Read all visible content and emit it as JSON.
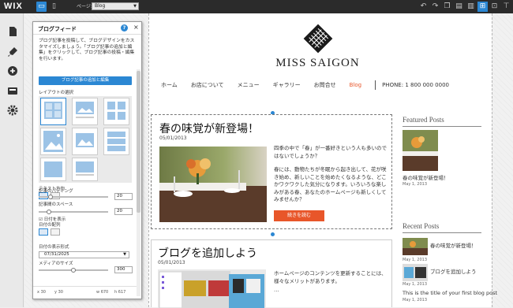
{
  "topbar": {
    "logo": "WIX",
    "page_label": "ページ:",
    "page_value": "Blog",
    "icons": [
      "desktop-view-icon",
      "mobile-view-icon",
      "undo-icon",
      "redo-icon",
      "copy-icon",
      "paste-icon",
      "gridlines-icon",
      "snap-icon",
      "rulers-icon"
    ]
  },
  "leftrail": {
    "icons": [
      "pages-icon",
      "design-icon",
      "add-icon",
      "app-market-icon",
      "settings-icon"
    ]
  },
  "panel": {
    "title": "ブログフィード",
    "help": "?",
    "close": "×",
    "description": "ブログ記事を投稿して、ブログデザインをカスタマイズしましょう。「ブログ記事の追加と編集」をクリックして、ブログ記事の投稿・編集を行います。",
    "add_button": "ブログ記事の追加と編集",
    "layout_label": "レイアウトの選択",
    "text_direction_label": "テキスト方向",
    "padding_label": "記事のパディング",
    "padding_value": "20",
    "padding_level": 0.15,
    "spacing_label": "記事間のスペース",
    "spacing_value": "20",
    "spacing_level": 0.12,
    "show_date_label": "日付を表示",
    "date_align_label": "日付の配列",
    "date_format_label": "日付の表示形式",
    "date_format_value": "07/31/2025",
    "media_size_label": "メディアのサイズ",
    "media_size_value": "300",
    "media_size_level": 0.5,
    "x_label": "x",
    "x_value": "30",
    "y_label": "y",
    "y_value": "30",
    "w_label": "w",
    "w_value": "670",
    "h_label": "h",
    "h_value": "617"
  },
  "site": {
    "brand": "MISS SAIGON",
    "nav": [
      "ホーム",
      "お店について",
      "メニュー",
      "ギャラリー",
      "お問合せ",
      "Blog"
    ],
    "active_nav": "Blog",
    "phone": "PHONE: 1 800 000 0000",
    "post1": {
      "title": "春の味覚が新登場！",
      "date": "05/01/2013",
      "text1": "四季の中で「春」が一番好きという人も多いのではないでしょうか？",
      "text2": "春には、動物たちが冬眠から起き出して、花が咲き始め、新しいことを始めたくなるような、どこかワクワクした気分になります。いろいろな楽しみがある春、あなたのホームページも新しくしてみませんか？",
      "read_more": "続きを読む"
    },
    "post2": {
      "title": "ブログを追加しよう",
      "date": "05/01/2013",
      "text": "ホームページのコンテンツを更新することには、様々なメリットがあります。",
      "more": "..."
    },
    "sidebar": {
      "featured_heading": "Featured Posts",
      "featured_post": "春の味覚が新登場！",
      "featured_date": "May 1, 2013",
      "recent_heading": "Recent Posts",
      "recent": [
        {
          "title": "春の味覚が新登場！",
          "date": "May 1, 2013"
        },
        {
          "title": "ブログを追加しよう",
          "date": "May 1, 2013"
        },
        {
          "title": "This is the title of your first blog post",
          "date": "May 1, 2013"
        }
      ]
    }
  },
  "colors": {
    "accent": "#2b87d3",
    "brand_orange": "#e8562a",
    "topbar": "#2b2b2b"
  }
}
